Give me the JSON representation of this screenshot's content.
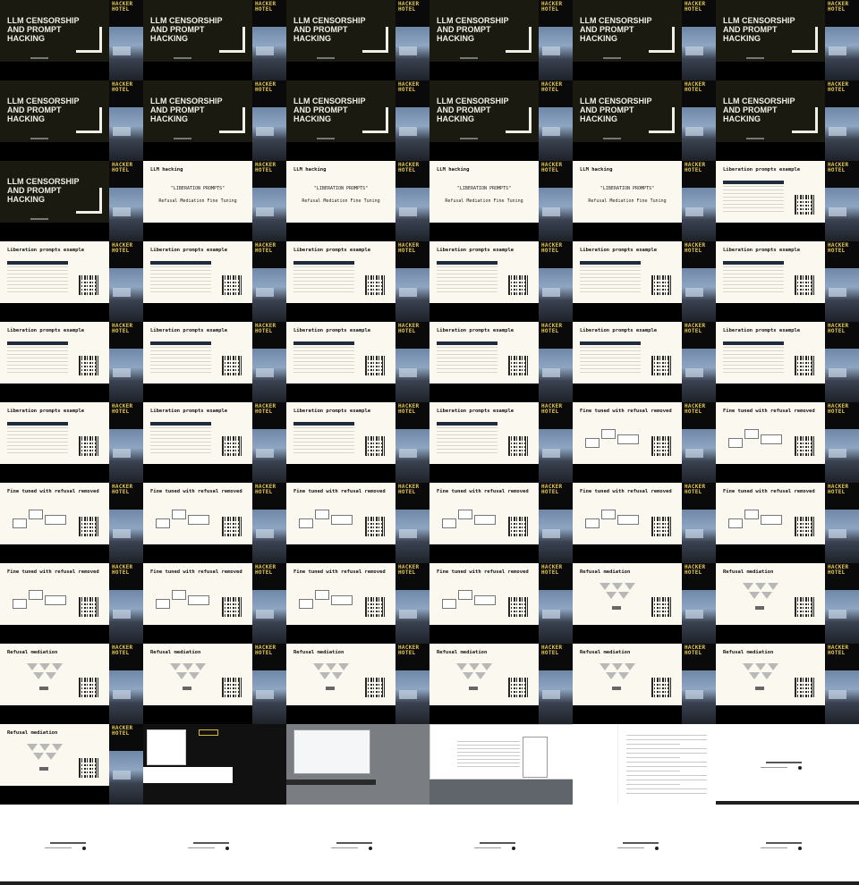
{
  "title_slide": {
    "title": "LLM CENSORSHIP AND PROMPT HACKING"
  },
  "side_logo": {
    "line1": "HACKER",
    "line2": "HOTEL"
  },
  "slides": {
    "llm_hacking": {
      "heading": "LLM hacking",
      "line1": "\"LIBERATION PROMPTS\"",
      "line2": "Refusal Mediation Fine Tuning"
    },
    "liberation": {
      "heading": "Liberation prompts example"
    },
    "fine_tuned": {
      "heading": "Fine tuned with refusal removed"
    },
    "refusal_mediation": {
      "heading": "Refusal mediation"
    }
  },
  "grid": {
    "columns": 6,
    "rows": 11,
    "sequence": [
      "title",
      "title",
      "title",
      "title",
      "title",
      "title",
      "title",
      "title",
      "title",
      "title",
      "title",
      "title",
      "title",
      "llm",
      "llm",
      "llm",
      "llm",
      "liberation",
      "liberation",
      "liberation",
      "liberation",
      "liberation",
      "liberation",
      "liberation",
      "liberation",
      "liberation",
      "liberation",
      "liberation",
      "liberation",
      "liberation",
      "liberation",
      "liberation",
      "liberation",
      "liberation",
      "fine",
      "fine",
      "fine",
      "fine",
      "fine",
      "fine",
      "fine",
      "fine",
      "fine",
      "fine",
      "fine",
      "fine",
      "refusal",
      "refusal",
      "refusal",
      "refusal",
      "refusal",
      "refusal",
      "refusal",
      "refusal",
      "refusal",
      "screen_dark",
      "screen_desktop",
      "screen_chat_dialog",
      "screen_chat_doc",
      "screen_chat_blank",
      "screen_chat_blank",
      "screen_chat_blank",
      "screen_chat_blank",
      "screen_chat_blank",
      "screen_chat_blank",
      "screen_chat_blank"
    ]
  }
}
